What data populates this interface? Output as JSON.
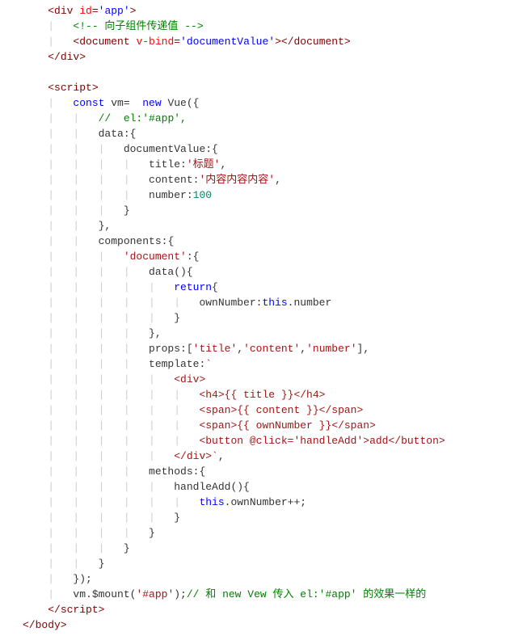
{
  "lines": [
    [
      {
        "cls": "guide",
        "txt": "    "
      },
      {
        "cls": "tag",
        "txt": "<div "
      },
      {
        "cls": "attr-name",
        "txt": "id"
      },
      {
        "cls": "tag",
        "txt": "="
      },
      {
        "cls": "attr-value",
        "txt": "'app'"
      },
      {
        "cls": "tag",
        "txt": ">"
      }
    ],
    [
      {
        "cls": "guide",
        "txt": "    |   "
      },
      {
        "cls": "comment",
        "txt": "<!-- 向子组件传递值 -->"
      }
    ],
    [
      {
        "cls": "guide",
        "txt": "    |   "
      },
      {
        "cls": "tag",
        "txt": "<document "
      },
      {
        "cls": "attr-name",
        "txt": "v-bind"
      },
      {
        "cls": "tag",
        "txt": "="
      },
      {
        "cls": "attr-value",
        "txt": "'documentValue'"
      },
      {
        "cls": "tag",
        "txt": "></document>"
      }
    ],
    [
      {
        "cls": "guide",
        "txt": "    "
      },
      {
        "cls": "tag",
        "txt": "</div>"
      }
    ],
    [
      {
        "cls": "txt",
        "txt": ""
      }
    ],
    [
      {
        "cls": "guide",
        "txt": "    "
      },
      {
        "cls": "tag",
        "txt": "<script>"
      }
    ],
    [
      {
        "cls": "guide",
        "txt": "    |   "
      },
      {
        "cls": "keyword",
        "txt": "const"
      },
      {
        "cls": "txt",
        "txt": " vm=  "
      },
      {
        "cls": "keyword",
        "txt": "new"
      },
      {
        "cls": "txt",
        "txt": " Vue({"
      }
    ],
    [
      {
        "cls": "guide",
        "txt": "    |   |   "
      },
      {
        "cls": "comment",
        "txt": "//  el:'#app',"
      }
    ],
    [
      {
        "cls": "guide",
        "txt": "    |   |   "
      },
      {
        "cls": "txt",
        "txt": "data:{"
      }
    ],
    [
      {
        "cls": "guide",
        "txt": "    |   |   |   "
      },
      {
        "cls": "txt",
        "txt": "documentValue:{"
      }
    ],
    [
      {
        "cls": "guide",
        "txt": "    |   |   |   |   "
      },
      {
        "cls": "txt",
        "txt": "title:"
      },
      {
        "cls": "string",
        "txt": "'标题'"
      },
      {
        "cls": "txt",
        "txt": ","
      }
    ],
    [
      {
        "cls": "guide",
        "txt": "    |   |   |   |   "
      },
      {
        "cls": "txt",
        "txt": "content:"
      },
      {
        "cls": "string",
        "txt": "'内容内容内容'"
      },
      {
        "cls": "txt",
        "txt": ","
      }
    ],
    [
      {
        "cls": "guide",
        "txt": "    |   |   |   |   "
      },
      {
        "cls": "txt",
        "txt": "number:"
      },
      {
        "cls": "number-lit",
        "txt": "100"
      }
    ],
    [
      {
        "cls": "guide",
        "txt": "    |   |   |   "
      },
      {
        "cls": "txt",
        "txt": "}"
      }
    ],
    [
      {
        "cls": "guide",
        "txt": "    |   |   "
      },
      {
        "cls": "txt",
        "txt": "},"
      }
    ],
    [
      {
        "cls": "guide",
        "txt": "    |   |   "
      },
      {
        "cls": "txt",
        "txt": "components:{"
      }
    ],
    [
      {
        "cls": "guide",
        "txt": "    |   |   |   "
      },
      {
        "cls": "string",
        "txt": "'document'"
      },
      {
        "cls": "txt",
        "txt": ":{"
      }
    ],
    [
      {
        "cls": "guide",
        "txt": "    |   |   |   |   "
      },
      {
        "cls": "txt",
        "txt": "data(){"
      }
    ],
    [
      {
        "cls": "guide",
        "txt": "    |   |   |   |   |   "
      },
      {
        "cls": "keyword",
        "txt": "return"
      },
      {
        "cls": "txt",
        "txt": "{"
      }
    ],
    [
      {
        "cls": "guide",
        "txt": "    |   |   |   |   |   |   "
      },
      {
        "cls": "txt",
        "txt": "ownNumber:"
      },
      {
        "cls": "keyword",
        "txt": "this"
      },
      {
        "cls": "txt",
        "txt": ".number"
      }
    ],
    [
      {
        "cls": "guide",
        "txt": "    |   |   |   |   |   "
      },
      {
        "cls": "txt",
        "txt": "}"
      }
    ],
    [
      {
        "cls": "guide",
        "txt": "    |   |   |   |   "
      },
      {
        "cls": "txt",
        "txt": "},"
      }
    ],
    [
      {
        "cls": "guide",
        "txt": "    |   |   |   |   "
      },
      {
        "cls": "txt",
        "txt": "props:["
      },
      {
        "cls": "string",
        "txt": "'title'"
      },
      {
        "cls": "txt",
        "txt": ","
      },
      {
        "cls": "string",
        "txt": "'content'"
      },
      {
        "cls": "txt",
        "txt": ","
      },
      {
        "cls": "string",
        "txt": "'number'"
      },
      {
        "cls": "txt",
        "txt": "],"
      }
    ],
    [
      {
        "cls": "guide",
        "txt": "    |   |   |   |   "
      },
      {
        "cls": "txt",
        "txt": "template:"
      },
      {
        "cls": "string",
        "txt": "`"
      }
    ],
    [
      {
        "cls": "guide",
        "txt": "    |   |   |   |   |   "
      },
      {
        "cls": "string",
        "txt": "<div>"
      }
    ],
    [
      {
        "cls": "guide",
        "txt": "    |   |   |   |   |   |   "
      },
      {
        "cls": "string",
        "txt": "<h4>{{ title }}</h4>"
      }
    ],
    [
      {
        "cls": "guide",
        "txt": "    |   |   |   |   |   |   "
      },
      {
        "cls": "string",
        "txt": "<span>{{ content }}</span>"
      }
    ],
    [
      {
        "cls": "guide",
        "txt": "    |   |   |   |   |   |   "
      },
      {
        "cls": "string",
        "txt": "<span>{{ ownNumber }}</span>"
      }
    ],
    [
      {
        "cls": "guide",
        "txt": "    |   |   |   |   |   |   "
      },
      {
        "cls": "string",
        "txt": "<button @click='handleAdd'>add</button>"
      }
    ],
    [
      {
        "cls": "guide",
        "txt": "    |   |   |   |   |   "
      },
      {
        "cls": "string",
        "txt": "</div>`"
      },
      {
        "cls": "txt",
        "txt": ","
      }
    ],
    [
      {
        "cls": "guide",
        "txt": "    |   |   |   |   "
      },
      {
        "cls": "txt",
        "txt": "methods:{"
      }
    ],
    [
      {
        "cls": "guide",
        "txt": "    |   |   |   |   |   "
      },
      {
        "cls": "txt",
        "txt": "handleAdd(){"
      }
    ],
    [
      {
        "cls": "guide",
        "txt": "    |   |   |   |   |   |   "
      },
      {
        "cls": "keyword",
        "txt": "this"
      },
      {
        "cls": "txt",
        "txt": ".ownNumber++;"
      }
    ],
    [
      {
        "cls": "guide",
        "txt": "    |   |   |   |   |   "
      },
      {
        "cls": "txt",
        "txt": "}"
      }
    ],
    [
      {
        "cls": "guide",
        "txt": "    |   |   |   |   "
      },
      {
        "cls": "txt",
        "txt": "}"
      }
    ],
    [
      {
        "cls": "guide",
        "txt": "    |   |   |   "
      },
      {
        "cls": "txt",
        "txt": "}"
      }
    ],
    [
      {
        "cls": "guide",
        "txt": "    |   |   "
      },
      {
        "cls": "txt",
        "txt": "}"
      }
    ],
    [
      {
        "cls": "guide",
        "txt": "    |   "
      },
      {
        "cls": "txt",
        "txt": "});"
      }
    ],
    [
      {
        "cls": "guide",
        "txt": "    |   "
      },
      {
        "cls": "txt",
        "txt": "vm.$mount("
      },
      {
        "cls": "string",
        "txt": "'#app'"
      },
      {
        "cls": "txt",
        "txt": ");"
      },
      {
        "cls": "comment",
        "txt": "// 和 new Vew 传入 el:'#app' 的效果一样的"
      }
    ],
    [
      {
        "cls": "guide",
        "txt": "    "
      },
      {
        "cls": "tag",
        "txt": "</script>"
      }
    ],
    [
      {
        "cls": "tag",
        "txt": "</body>"
      }
    ]
  ]
}
